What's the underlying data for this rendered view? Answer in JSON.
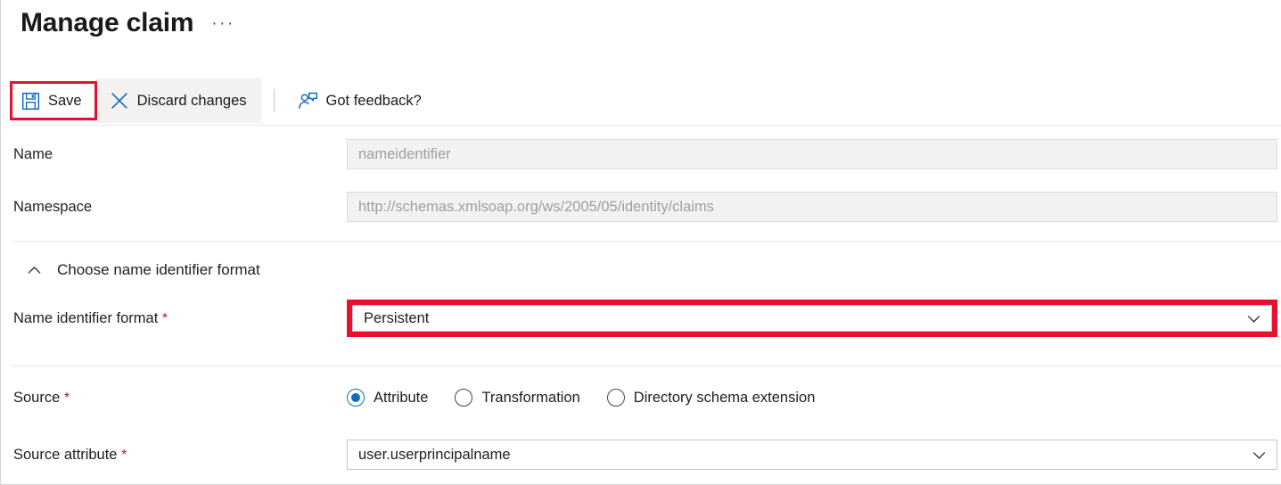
{
  "header": {
    "title": "Manage claim",
    "more_label": "···"
  },
  "toolbar": {
    "save_label": "Save",
    "discard_label": "Discard changes",
    "feedback_label": "Got feedback?"
  },
  "form": {
    "name": {
      "label": "Name",
      "value": "nameidentifier",
      "disabled": true
    },
    "namespace": {
      "label": "Namespace",
      "value": "http://schemas.xmlsoap.org/ws/2005/05/identity/claims",
      "disabled": true
    },
    "section": {
      "label": "Choose name identifier format",
      "expanded": true
    },
    "name_identifier_format": {
      "label": "Name identifier format",
      "required_marker": "*",
      "value": "Persistent",
      "highlighted": true
    },
    "source": {
      "label": "Source",
      "required_marker": "*",
      "options": [
        {
          "label": "Attribute",
          "selected": true
        },
        {
          "label": "Transformation",
          "selected": false
        },
        {
          "label": "Directory schema extension",
          "selected": false
        }
      ]
    },
    "source_attribute": {
      "label": "Source attribute",
      "required_marker": "*",
      "value": "user.userprincipalname"
    }
  },
  "colors": {
    "highlight": "#e8112d",
    "accent": "#0f6cbd",
    "required": "#a4262c",
    "disabled_bg": "#f3f2f1"
  }
}
